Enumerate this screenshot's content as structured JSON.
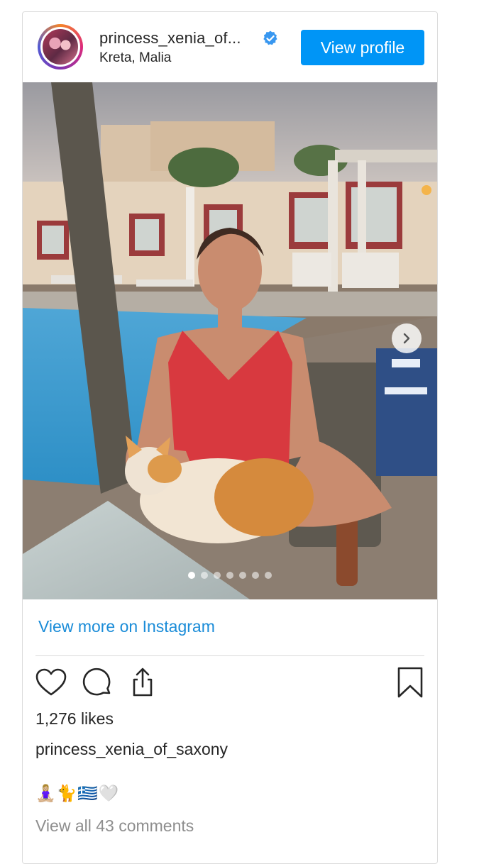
{
  "post": {
    "username": "princess_xenia_of...",
    "location": "Kreta, Malia",
    "verified_icon": "verified-badge-icon",
    "view_profile_label": "View profile",
    "view_more_label": "View more on Instagram",
    "likes": "1,276 likes",
    "caption_username": "princess_xenia_of_saxony",
    "caption_emojis": "🧘🏼‍♀️🐈🇬🇷🤍",
    "comments_label": "View all 43 comments",
    "carousel": {
      "slide_count": 7,
      "active_index": 0
    },
    "colors": {
      "accent": "#0095f6",
      "link": "#1a8cd8",
      "muted": "#8e8e8e",
      "border": "#dbdbdb"
    },
    "icons": [
      "heart-icon",
      "comment-icon",
      "share-icon",
      "bookmark-icon",
      "chevron-right-icon"
    ]
  }
}
